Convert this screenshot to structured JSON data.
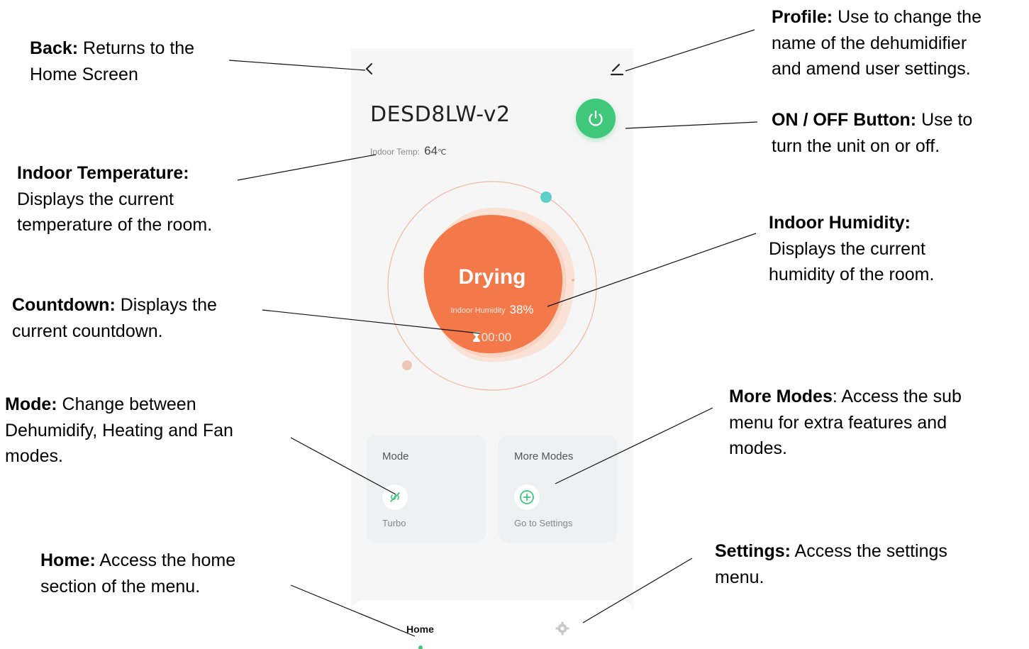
{
  "app": {
    "device_name": "DESD8LW-v2",
    "indoor_temp_label": "Indoor Temp:",
    "indoor_temp_value": "64",
    "indoor_temp_unit": "℃",
    "status_title": "Drying",
    "humidity_label": "Indoor Humidity",
    "humidity_value": "38%",
    "countdown": "00:00",
    "cards": {
      "mode": {
        "label": "Mode",
        "sub": "Turbo",
        "icon": "turbo-icon"
      },
      "more": {
        "label": "More Modes",
        "sub": "Go to Settings",
        "icon": "plus-circle-icon"
      }
    },
    "nav": {
      "home_label": "Home",
      "settings_icon": "gear-icon"
    },
    "colors": {
      "accent_green": "#3fc77a",
      "drying_orange": "#f4794a",
      "teal_dot": "#5ccfc9"
    }
  },
  "callouts": {
    "back": {
      "title": "Back:",
      "text1": " Returns to the",
      "text2": "Home Screen"
    },
    "profile": {
      "title": "Profile:",
      "text1": " Use to change the",
      "text2": "name of the dehumidifier",
      "text3": "and amend user settings."
    },
    "power": {
      "title": "ON / OFF Button:",
      "text1": " Use to",
      "text2": "turn the unit on or off."
    },
    "temperature": {
      "title": "Indoor Temperature:",
      "text1": "Displays the current",
      "text2": "temperature of the room."
    },
    "humidity": {
      "title": "Indoor Humidity:",
      "text1": "Displays the current",
      "text2": "humidity of the room."
    },
    "countdown": {
      "title": "Countdown:",
      "text1": " Displays the",
      "text2": "current countdown."
    },
    "mode": {
      "title": "Mode:",
      "text1": " Change between",
      "text2": "Dehumidify, Heating and Fan",
      "text3": "modes."
    },
    "more_modes": {
      "title": "More Modes",
      "text1": ": Access the sub",
      "text2": "menu for extra features and",
      "text3": "modes."
    },
    "home": {
      "title": "Home:",
      "text1": " Access the home",
      "text2": "section of the menu."
    },
    "settings": {
      "title": "Settings:",
      "text1": " Access the settings",
      "text2": "menu."
    }
  }
}
